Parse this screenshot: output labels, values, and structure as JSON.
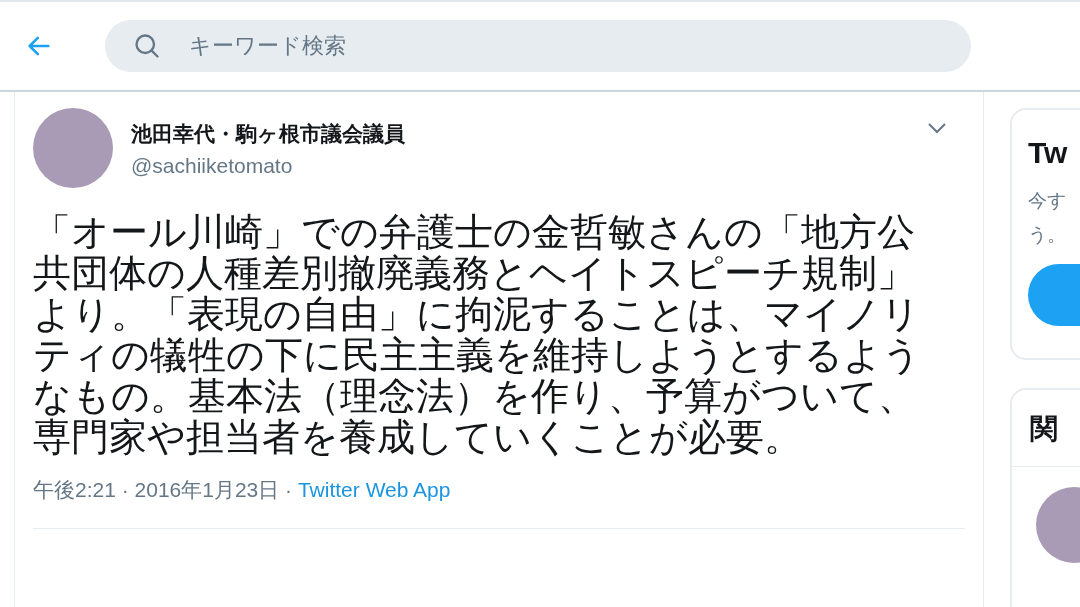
{
  "header": {
    "search": {
      "placeholder": "キーワード検索"
    }
  },
  "tweet": {
    "author_name": "池田幸代・駒ヶ根市議会議員",
    "handle": "@sachiiketomato",
    "text": "「オール川崎」での弁護士の金哲敏さんの「地方公共団体の人種差別撤廃義務とヘイトスピーチ規制」より。「表現の自由」に拘泥することは、マイノリティの犠牲の下に民主主義を維持しようとするようなもの。基本法（理念法）を作り、予算がついて、専門家や担当者を養成していくことが必要。",
    "timestamp": "午後2:21 · 2016年1月23日 · ",
    "source": "Twitter Web App"
  },
  "sidebar": {
    "signup_card": {
      "title": "Tw",
      "text_lines": [
        "今す",
        "う。"
      ]
    },
    "related_card": {
      "title": "関"
    }
  }
}
